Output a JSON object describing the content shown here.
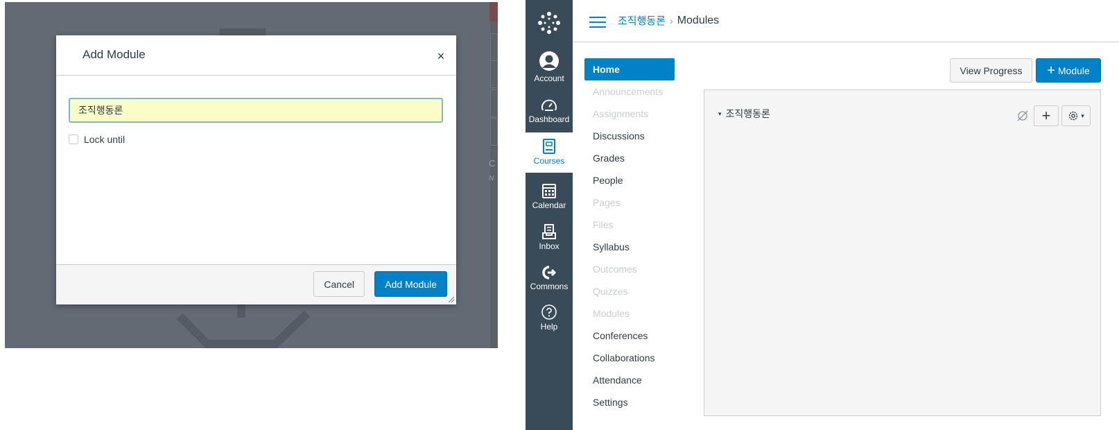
{
  "add_module_dialog": {
    "title": "Add Module",
    "close_label": "×",
    "name_value": "조직행동론",
    "lock_until_label": "Lock until",
    "cancel_label": "Cancel",
    "submit_label": "Add Module"
  },
  "background_partial": {
    "text_c": "C",
    "text_n": "N"
  },
  "global_nav": {
    "items": [
      {
        "label": "Account",
        "icon": "account-icon"
      },
      {
        "label": "Dashboard",
        "icon": "dashboard-icon"
      },
      {
        "label": "Courses",
        "icon": "courses-icon",
        "active": true
      },
      {
        "label": "Calendar",
        "icon": "calendar-icon"
      },
      {
        "label": "Inbox",
        "icon": "inbox-icon"
      },
      {
        "label": "Commons",
        "icon": "commons-icon"
      },
      {
        "label": "Help",
        "icon": "help-icon"
      }
    ]
  },
  "breadcrumb": {
    "course": "조직행동론",
    "separator": "›",
    "current": "Modules"
  },
  "course_nav": {
    "items": [
      {
        "label": "Home",
        "state": "active"
      },
      {
        "label": "Announcements",
        "state": "disabled"
      },
      {
        "label": "Assignments",
        "state": "disabled"
      },
      {
        "label": "Discussions",
        "state": "enabled"
      },
      {
        "label": "Grades",
        "state": "enabled"
      },
      {
        "label": "People",
        "state": "enabled"
      },
      {
        "label": "Pages",
        "state": "disabled"
      },
      {
        "label": "Files",
        "state": "disabled"
      },
      {
        "label": "Syllabus",
        "state": "enabled"
      },
      {
        "label": "Outcomes",
        "state": "disabled"
      },
      {
        "label": "Quizzes",
        "state": "disabled"
      },
      {
        "label": "Modules",
        "state": "disabled"
      },
      {
        "label": "Conferences",
        "state": "enabled"
      },
      {
        "label": "Collaborations",
        "state": "enabled"
      },
      {
        "label": "Attendance",
        "state": "enabled"
      },
      {
        "label": "Settings",
        "state": "enabled"
      }
    ]
  },
  "toolbar": {
    "view_progress_label": "View Progress",
    "add_module_label": "Module",
    "add_module_plus": "+"
  },
  "modules": {
    "items": [
      {
        "name": "조직행동론",
        "published": false
      }
    ]
  },
  "colors": {
    "accent": "#0081c8",
    "nav_bg": "#394b58",
    "overlay": "#626a74",
    "input_highlight": "#fbfdc8"
  }
}
